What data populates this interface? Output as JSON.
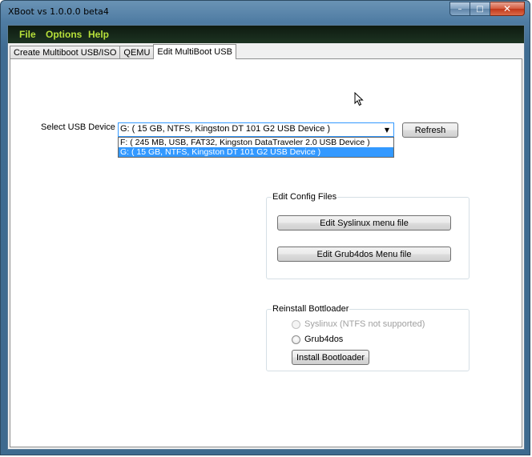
{
  "window": {
    "title": "XBoot vs 1.0.0.0 beta4"
  },
  "caption": {
    "minimize": "–",
    "maximize": "□",
    "close": "✕"
  },
  "menu": {
    "items": [
      "File",
      "Options",
      "Help"
    ]
  },
  "tabs": [
    {
      "label": "Create Multiboot USB/ISO"
    },
    {
      "label": "QEMU"
    },
    {
      "label": "Edit MultiBoot USB",
      "active": true
    }
  ],
  "usb": {
    "label": "Select USB Device :",
    "selected": "G:  ( 15 GB,   NTFS,   Kingston DT 101 G2 USB Device )",
    "options": [
      "F:  ( 245 MB,   USB,   FAT32,   Kingston DataTraveler 2.0 USB Device )",
      "G:  ( 15 GB,   NTFS,   Kingston DT 101 G2 USB Device )"
    ],
    "selected_index": 1,
    "refresh_label": "Refresh"
  },
  "edit_config": {
    "title": "Edit Config Files",
    "syslinux_button": "Edit Syslinux menu file",
    "grub_button": "Edit Grub4dos Menu file"
  },
  "reinstall": {
    "title": "Reinstall Bottloader",
    "syslinux_option": "Syslinux (NTFS not supported)",
    "grub_option": "Grub4dos",
    "install_button": "Install Bootloader"
  },
  "colors": {
    "menu_text": "#b7e03a",
    "selection": "#3399ff",
    "focus_border": "#3399ff"
  }
}
